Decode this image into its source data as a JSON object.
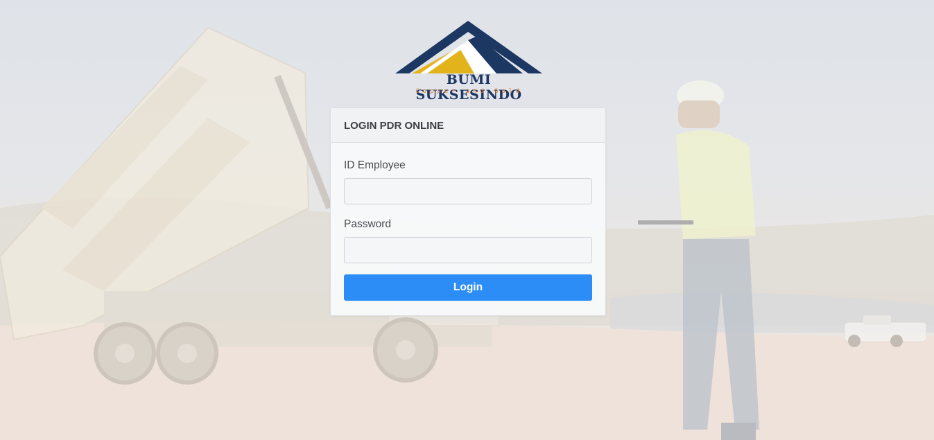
{
  "branding": {
    "company_name": "BUMI SUKSESINDO",
    "tagline": "Copper and Gold",
    "colors": {
      "navy": "#1d3763",
      "gold": "#e2b31a",
      "orange": "#e0792a"
    }
  },
  "login_card": {
    "title": "LOGIN PDR ONLINE",
    "employee_id": {
      "label": "ID Employee",
      "value": "",
      "placeholder": ""
    },
    "password": {
      "label": "Password",
      "value": "",
      "placeholder": ""
    },
    "submit_label": "Login",
    "accent_color": "#2b8df5"
  },
  "background": {
    "description_icon": "mining-site-photo"
  }
}
